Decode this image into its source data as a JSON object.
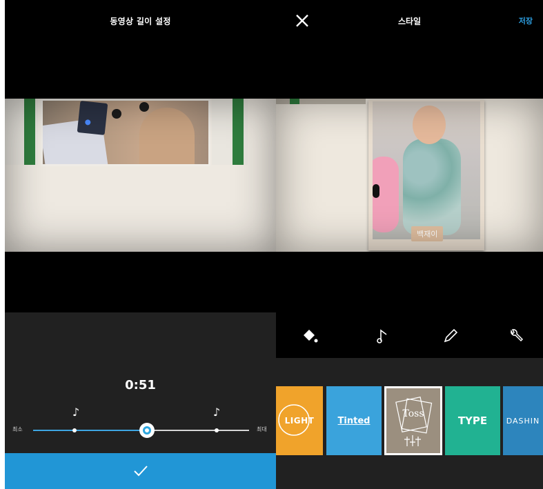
{
  "left": {
    "title": "동영상 길이 설정",
    "time": "0:51",
    "min_label": "최소",
    "max_label": "최대",
    "confirm": "✓",
    "slider_position": 0.52,
    "note_icon": "music-note-icon"
  },
  "right": {
    "title": "스타일",
    "save": "저장",
    "close_icon": "close-icon",
    "name_tag": "백재이",
    "tools": [
      "paint-bucket-icon",
      "music-note-icon",
      "pencil-icon",
      "wrench-icon"
    ],
    "styles": [
      {
        "label": "LIGHT",
        "color": "#f0a32b"
      },
      {
        "label": "Tinted",
        "color": "#3aa3dc"
      },
      {
        "label": "Toss",
        "color": "#9b8f7f",
        "selected": true
      },
      {
        "label": "TYPE",
        "color": "#21b292"
      },
      {
        "label": "DASHIN",
        "color": "#2d85bd"
      }
    ]
  },
  "colors": {
    "accent": "#2196d6",
    "background": "#000000",
    "controls": "#212121"
  }
}
